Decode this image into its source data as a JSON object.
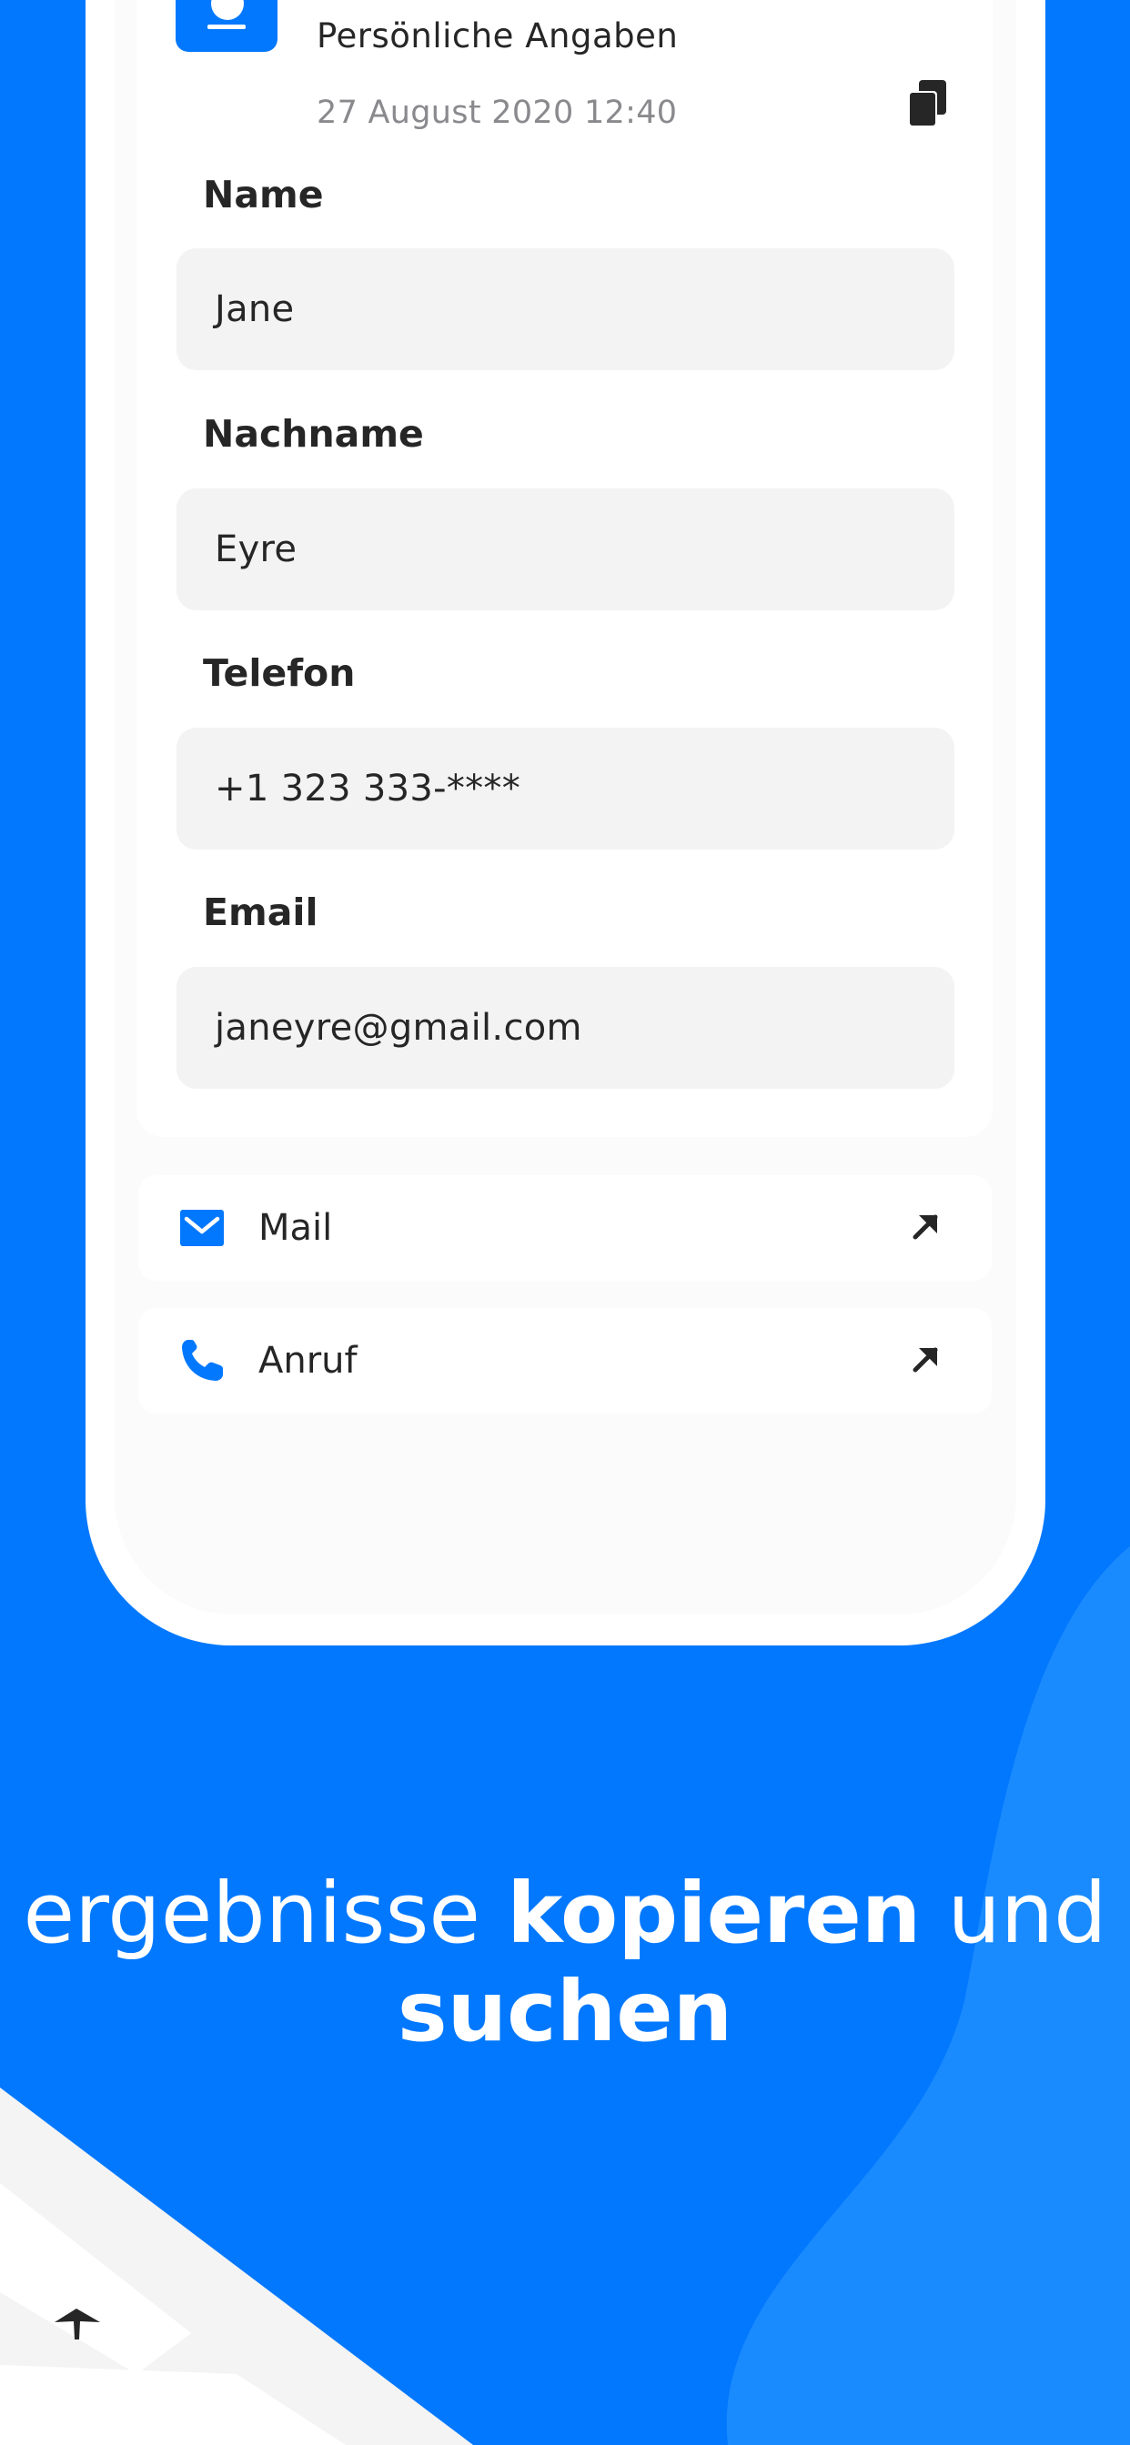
{
  "contact_card": {
    "title": "Persönliche Angaben",
    "timestamp": "27 August 2020 12:40"
  },
  "fields": [
    {
      "label": "Name",
      "value": "Jane"
    },
    {
      "label": "Nachname",
      "value": "Eyre"
    },
    {
      "label": "Telefon",
      "value": "+1 323 333-****"
    },
    {
      "label": "Email",
      "value": "janeyre@gmail.com"
    }
  ],
  "actions": [
    {
      "label": "Mail",
      "icon": "mail-icon"
    },
    {
      "label": "Anruf",
      "icon": "phone-icon"
    }
  ],
  "headline": {
    "part1": "ergebnisse ",
    "part2_bold": "kopieren",
    "part3": " und",
    "part4_bold": "suchen"
  },
  "colors": {
    "background": "#0278FE",
    "accent": "#0278FE",
    "field_bg": "#F3F3F3",
    "text": "#262626",
    "muted": "#8A8A8E"
  }
}
